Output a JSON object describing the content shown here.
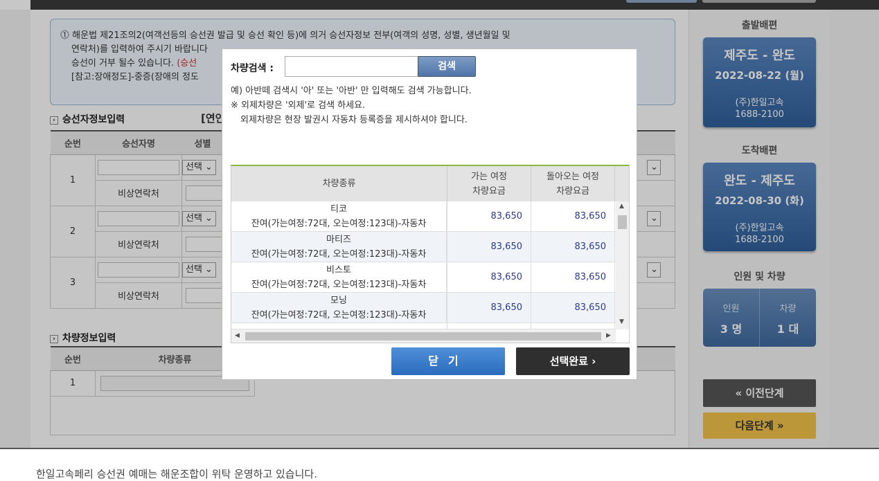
{
  "notice": {
    "line1": "해운법 제21조의2(여객선등의 승선권 발급 및 승선 확인 등)에 의거 승선자정보 전부(여객의 성명, 성별, 생년월일 및",
    "line2": "연락처)를 입력하여 주시기 바랍니다",
    "line3a": "승선이 거부 될수 있습니다.",
    "line3b": "(승선",
    "line4": "[참고:장애정도]-중증(장애의 정도"
  },
  "passenger_section": {
    "title": "승선자정보입력",
    "extra": "[연인",
    "headers": [
      "순번",
      "승선자명",
      "성별"
    ],
    "rows": [
      {
        "no": "1",
        "gender": "선택",
        "emergency": "비상연락처"
      },
      {
        "no": "2",
        "gender": "선택",
        "emergency": "비상연락처"
      },
      {
        "no": "3",
        "gender": "선택",
        "emergency": "비상연락처"
      }
    ]
  },
  "vehicle_section": {
    "title": "차량정보입력",
    "headers": [
      "순번",
      "차량종류"
    ],
    "rows": [
      {
        "no": "1"
      }
    ]
  },
  "sidebar": {
    "depart_caption": "출발배편",
    "depart": {
      "route": "제주도 - 완도",
      "date": "2022-08-22 (월)",
      "company": "(주)한일고속",
      "phone": "1688-2100"
    },
    "arrive_caption": "도착배편",
    "arrive": {
      "route": "완도 - 제주도",
      "date": "2022-08-30 (화)",
      "company": "(주)한일고속",
      "phone": "1688-2100"
    },
    "people_caption": "인원 및 차량",
    "people_label": "인원",
    "people_value": "3 명",
    "vehicle_label": "차량",
    "vehicle_value": "1 대",
    "prev_button": "«  이전단계",
    "next_button": "다음단계  »"
  },
  "footer": "한일고속페리 승선권 예매는 해운조합이 위탁 운영하고 있습니다.",
  "modal": {
    "search_label": "차량검색 :",
    "search_value": "",
    "search_button": "검색",
    "help1": "예) 아반떼 검색시 '아' 또는 '아반' 만 입력해도 검색 가능합니다.",
    "help2": "※ 외제차량은 '외제'로 검색 하세요.",
    "help3": "외제차량은 현장 발권시 자동차 등록증을 제시하셔야 합니다.",
    "col_type": "차량종류",
    "col_out_1": "가는 여정",
    "col_out_2": "차량요금",
    "col_back_1": "돌아오는 여정",
    "col_back_2": "차량요금",
    "vehicles": [
      {
        "name": "티코",
        "remain": "잔여(가는여정:72대, 오는여정:123대)-자동차",
        "fare_out": "83,650",
        "fare_back": "83,650"
      },
      {
        "name": "마티즈",
        "remain": "잔여(가는여정:72대, 오는여정:123대)-자동차",
        "fare_out": "83,650",
        "fare_back": "83,650"
      },
      {
        "name": "비스토",
        "remain": "잔여(가는여정:72대, 오는여정:123대)-자동차",
        "fare_out": "83,650",
        "fare_back": "83,650"
      },
      {
        "name": "모닝",
        "remain": "잔여(가는여정:72대, 오는여정:123대)-자동차",
        "fare_out": "83,650",
        "fare_back": "83,650"
      }
    ],
    "close_button": "닫기",
    "done_button": "선택완료 ›"
  }
}
